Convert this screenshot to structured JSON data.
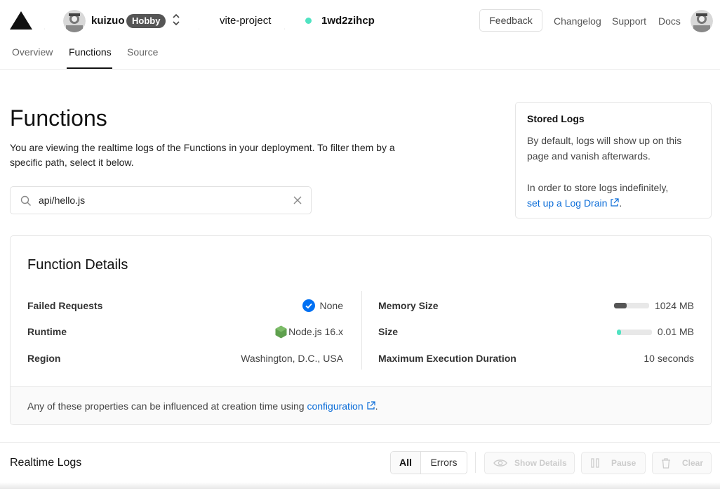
{
  "header": {
    "user_name": "kuizuo",
    "plan_badge": "Hobby",
    "project": "vite-project",
    "deployment_id": "1wd2zihcp",
    "deployment_status_color": "#50e3c2",
    "feedback_label": "Feedback",
    "nav": [
      "Changelog",
      "Support",
      "Docs"
    ]
  },
  "tabs": [
    "Overview",
    "Functions",
    "Source"
  ],
  "active_tab": "Functions",
  "main": {
    "title": "Functions",
    "description": "You are viewing the realtime logs of the Functions in your deployment. To filter them by a specific path, select it below.",
    "search_value": "api/hello.js"
  },
  "stored_logs": {
    "title": "Stored Logs",
    "text1": "By default, logs will show up on this page and vanish afterwards.",
    "text2_prefix": "In order to store logs indefinitely,",
    "link": "set up a Log Drain",
    "text2_suffix": "."
  },
  "details": {
    "title": "Function Details",
    "left": [
      {
        "label": "Failed Requests",
        "value": "None",
        "icon": "check-circle-icon"
      },
      {
        "label": "Runtime",
        "value": "Node.js 16.x",
        "icon": "nodejs-icon"
      },
      {
        "label": "Region",
        "value": "Washington, D.C., USA"
      }
    ],
    "right": [
      {
        "label": "Memory Size",
        "value": "1024 MB",
        "usage": 0.35
      },
      {
        "label": "Size",
        "value": "0.01 MB",
        "usage": 0.12
      },
      {
        "label": "Maximum Execution Duration",
        "value": "10 seconds"
      }
    ],
    "footer_prefix": "Any of these properties can be influenced at creation time using",
    "footer_link": "configuration",
    "footer_suffix": "."
  },
  "realtime": {
    "title": "Realtime Logs",
    "filter_all": "All",
    "filter_errors": "Errors",
    "show_details": "Show Details",
    "pause": "Pause",
    "clear": "Clear"
  },
  "colors": {
    "accent_link": "#0a6cd8",
    "check_blue": "#0070f3",
    "node_green": "#5fa04e",
    "memory_bar": "#555555",
    "size_bar": "#50e3c2"
  }
}
